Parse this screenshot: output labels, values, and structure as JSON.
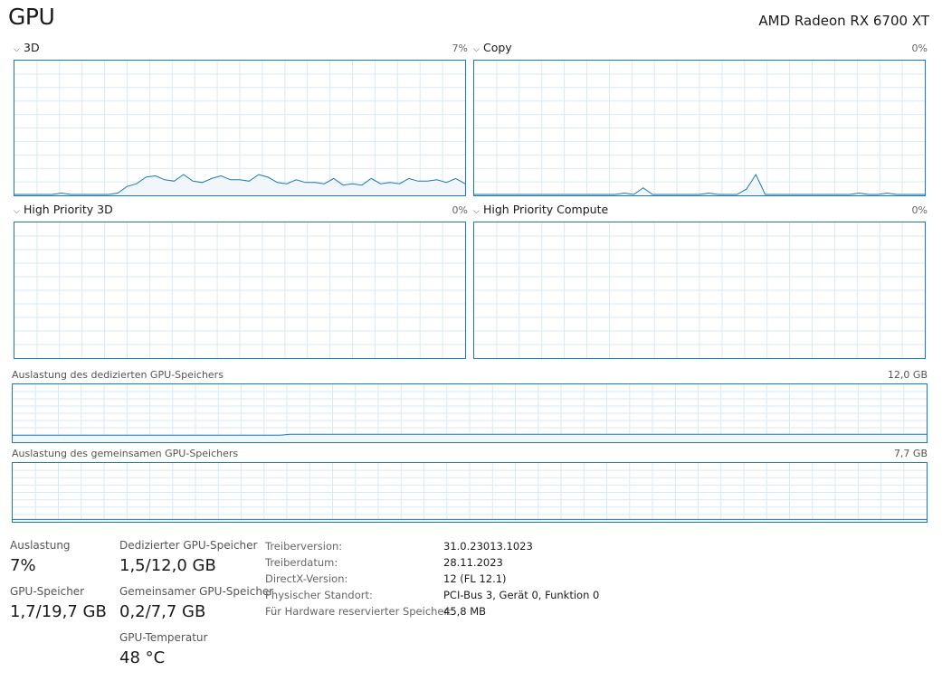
{
  "header": {
    "title": "GPU",
    "device": "AMD Radeon RX 6700 XT"
  },
  "engines": [
    {
      "name": "3D",
      "percent": "7%",
      "values": [
        0,
        0,
        0,
        0,
        0,
        1,
        0,
        0,
        0,
        0,
        0,
        1,
        6,
        8,
        13,
        14,
        11,
        10,
        15,
        10,
        9,
        12,
        14,
        11,
        11,
        10,
        15,
        13,
        9,
        8,
        11,
        9,
        9,
        8,
        12,
        7,
        8,
        7,
        12,
        8,
        9,
        8,
        12,
        10,
        10,
        11,
        9,
        12,
        8
      ]
    },
    {
      "name": "Copy",
      "percent": "0%",
      "values": [
        0,
        0,
        0,
        0,
        0,
        0,
        0,
        0,
        0,
        0,
        0,
        0,
        0,
        0,
        0,
        0,
        1,
        0,
        5,
        0,
        0,
        0,
        0,
        0,
        0,
        1,
        0,
        0,
        0,
        4,
        15,
        0,
        0,
        0,
        0,
        0,
        0,
        0,
        0,
        0,
        0,
        1,
        0,
        0,
        1,
        0,
        0,
        0,
        0
      ]
    },
    {
      "name": "High Priority 3D",
      "percent": "0%",
      "values": []
    },
    {
      "name": "High Priority Compute",
      "percent": "0%",
      "values": []
    }
  ],
  "memory_charts": [
    {
      "title": "Auslastung des dedizierten GPU-Speichers",
      "max": "12,0 GB",
      "values": [
        0.11,
        0.11,
        0.11,
        0.11,
        0.11,
        0.11,
        0.11,
        0.11,
        0.11,
        0.11,
        0.11,
        0.11,
        0.11,
        0.11,
        0.11,
        0.11,
        0.11,
        0.11,
        0.11,
        0.11,
        0.11,
        0.11,
        0.11,
        0.11,
        0.11,
        0.11,
        0.11,
        0.11,
        0.11,
        0.11,
        0.125,
        0.125,
        0.125,
        0.125,
        0.125,
        0.125,
        0.125,
        0.125,
        0.125,
        0.125,
        0.125,
        0.125,
        0.125,
        0.125,
        0.125,
        0.125,
        0.125,
        0.125,
        0.125,
        0.125,
        0.125,
        0.125,
        0.125,
        0.125,
        0.125,
        0.125,
        0.125,
        0.125,
        0.125,
        0.125,
        0.125,
        0.125,
        0.125,
        0.125,
        0.125,
        0.125,
        0.125,
        0.125,
        0.125,
        0.125,
        0.125,
        0.125,
        0.125,
        0.125,
        0.125,
        0.125,
        0.125,
        0.125,
        0.125,
        0.125,
        0.125,
        0.125,
        0.125,
        0.125,
        0.125,
        0.125,
        0.125,
        0.125,
        0.125,
        0.125,
        0.125,
        0.125,
        0.125,
        0.125,
        0.125,
        0.125,
        0.125,
        0.125,
        0.125,
        0.125
      ]
    },
    {
      "title": "Auslastung des gemeinsamen GPU-Speichers",
      "max": "7,7 GB",
      "values": [
        0.026,
        0.026,
        0.026,
        0.026,
        0.026,
        0.026,
        0.026,
        0.026,
        0.026,
        0.026,
        0.026,
        0.026,
        0.026,
        0.026,
        0.026,
        0.026,
        0.026,
        0.026,
        0.026,
        0.026,
        0.026,
        0.026,
        0.026,
        0.026,
        0.026,
        0.026,
        0.026,
        0.026,
        0.026,
        0.026,
        0.026,
        0.026,
        0.026,
        0.026,
        0.026,
        0.026,
        0.026,
        0.026,
        0.026,
        0.026,
        0.026,
        0.026,
        0.026,
        0.026,
        0.026,
        0.026,
        0.026,
        0.026,
        0.026,
        0.026
      ]
    }
  ],
  "stats": {
    "usage_label": "Auslastung",
    "usage_value": "7%",
    "gpu_mem_label": "GPU-Speicher",
    "gpu_mem_value": "1,7/19,7 GB",
    "dedicated_label": "Dedizierter GPU-Speicher",
    "dedicated_value": "1,5/12,0 GB",
    "shared_label": "Gemeinsamer GPU-Speicher",
    "shared_value": "0,2/7,7 GB",
    "temp_label": "GPU-Temperatur",
    "temp_value": "48 °C"
  },
  "details": [
    {
      "key": "Treiberversion:",
      "value": "31.0.23013.1023"
    },
    {
      "key": "Treiberdatum:",
      "value": "28.11.2023"
    },
    {
      "key": "DirectX-Version:",
      "value": "12 (FL 12.1)"
    },
    {
      "key": "Physischer Standort:",
      "value": "PCI-Bus 3, Gerät 0, Funktion 0"
    },
    {
      "key": "Für Hardware reservierter Speicher:",
      "value": "45,8 MB"
    }
  ],
  "colors": {
    "line": "#1b7ab6",
    "fill": "#f1f6fa",
    "grid": "#d9eaf5"
  },
  "icons": {
    "collapse": "chevron-down-icon"
  }
}
